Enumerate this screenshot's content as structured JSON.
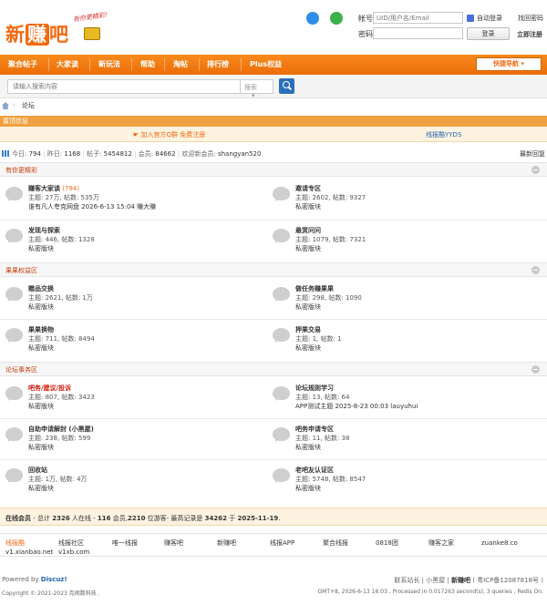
{
  "brand": {
    "logo_text_1": "新",
    "logo_text_2": "赚",
    "logo_text_3": "吧",
    "slogan": "有你更精彩!"
  },
  "login": {
    "account_label": "帐号",
    "account_placeholder": "UID/用户名/Email",
    "password_label": "密码",
    "auto_login_label": "自动登录",
    "forgot_password": "找回密码",
    "login_button": "登录",
    "register": "立即注册"
  },
  "nav": {
    "items": [
      "聚合帖子",
      "大家谈",
      "新玩法",
      "帮助",
      "淘帖",
      "排行榜",
      "Plus权益"
    ],
    "quick_nav": "快捷导航"
  },
  "search": {
    "placeholder": "请输入搜索内容",
    "type": "搜索"
  },
  "breadcrumb": {
    "current": "论坛"
  },
  "announcement": {
    "header": "置顶信息",
    "left_text": "加入官方Q群 免费注册",
    "right_text": "线报酷YYDS"
  },
  "stats": {
    "today_label": "今日:",
    "today": "794",
    "yesterday_label": "昨日:",
    "yesterday": "1168",
    "posts_label": "帖子:",
    "posts": "5454812",
    "members_label": "会员:",
    "members": "84662",
    "welcome_label": "欢迎新会员:",
    "new_member": "shangyan520",
    "latest_reply": "最新回复"
  },
  "categories": [
    {
      "title": "有你更精彩",
      "forums": [
        {
          "name": "赚客大家谈",
          "count": "(794)",
          "meta": "主题: 27万, 帖数: 535万",
          "last": "谁有凡人夸克网盘 2026-6-13 15:04 賺大賺"
        },
        {
          "name": "邀请专区",
          "count": "",
          "meta": "主题: 2602, 帖数: 9327",
          "last": "私密版块"
        },
        {
          "name": "发现与探索",
          "count": "",
          "meta": "主题: 446, 帖数: 1328",
          "last": "私密版块"
        },
        {
          "name": "悬赏问问",
          "count": "",
          "meta": "主题: 1079, 帖数: 7321",
          "last": "私密版块"
        }
      ]
    },
    {
      "title": "果果权益区",
      "forums": [
        {
          "name": "赠品交换",
          "count": "",
          "meta": "主题: 2621, 帖数: 1万",
          "last": "私密版块"
        },
        {
          "name": "做任务赚果果",
          "count": "",
          "meta": "主题: 298, 帖数: 1090",
          "last": "私密版块"
        },
        {
          "name": "果果换物",
          "count": "",
          "meta": "主题: 711, 帖数: 8494",
          "last": "私密版块"
        },
        {
          "name": "押果交易",
          "count": "",
          "meta": "主题: 1, 帖数: 1",
          "last": "私密版块"
        }
      ]
    },
    {
      "title": "论坛事务区",
      "forums": [
        {
          "name": "吧务/建议/投诉",
          "count": "",
          "meta": "主题: 807, 帖数: 3423",
          "last": "私密版块"
        },
        {
          "name": "论坛规则学习",
          "count": "",
          "meta": "主题: 13, 帖数: 64",
          "last": "APP测试主题 2025-8-23 00:03 lauyuhui"
        },
        {
          "name": "自助申请解封 (小黑屋)",
          "count": "",
          "meta": "主题: 238, 帖数: 599",
          "last": "私密版块"
        },
        {
          "name": "吧务申请专区",
          "count": "",
          "meta": "主题: 11, 帖数: 38",
          "last": "私密版块"
        },
        {
          "name": "回收站",
          "count": "",
          "meta": "主题: 1万, 帖数: 4万",
          "last": "私密版块"
        },
        {
          "name": "老吧友认证区",
          "count": "",
          "meta": "主题: 5748, 帖数: 8547",
          "last": "私密版块"
        }
      ]
    }
  ],
  "online": {
    "label": "在线会员",
    "text1": " - 总计 ",
    "total": "2326",
    "text2": " 人在线 - ",
    "members": "116",
    "text3": " 会员,",
    "guests": "2210",
    "text4": " 位游客- 最高记录是 ",
    "record": "34262",
    "text5": " 于 ",
    "record_date": "2025-11-19",
    "text6": "."
  },
  "links": [
    {
      "label": "线报酷",
      "sub": "v1.xianbao.net"
    },
    {
      "label": "线报社区",
      "sub": "v1xb.com"
    },
    {
      "label": "唯一线报",
      "sub": ""
    },
    {
      "label": "赚客吧",
      "sub": ""
    },
    {
      "label": "新赚吧",
      "sub": ""
    },
    {
      "label": "线报APP",
      "sub": ""
    },
    {
      "label": "聚合线报",
      "sub": ""
    },
    {
      "label": "0818团",
      "sub": ""
    },
    {
      "label": "赚客之家",
      "sub": ""
    },
    {
      "label": "zuanke8.co",
      "sub": ""
    }
  ],
  "footer": {
    "powered_by": "Powered by ",
    "discuz": "Discuz!",
    "copyright": "Copyright © 2021-2023 克闻数科技 .",
    "right_line1_a": "联系站长",
    "right_line1_b": "小黑屋",
    "right_line1_c": "新赚吧",
    "right_line1_d": "( 粤ICP备12087818号 )",
    "right_line2": "GMT+8, 2026-6-13 16:03 , Processed in 0.017263 second(s), 3 queries , Redis On."
  }
}
